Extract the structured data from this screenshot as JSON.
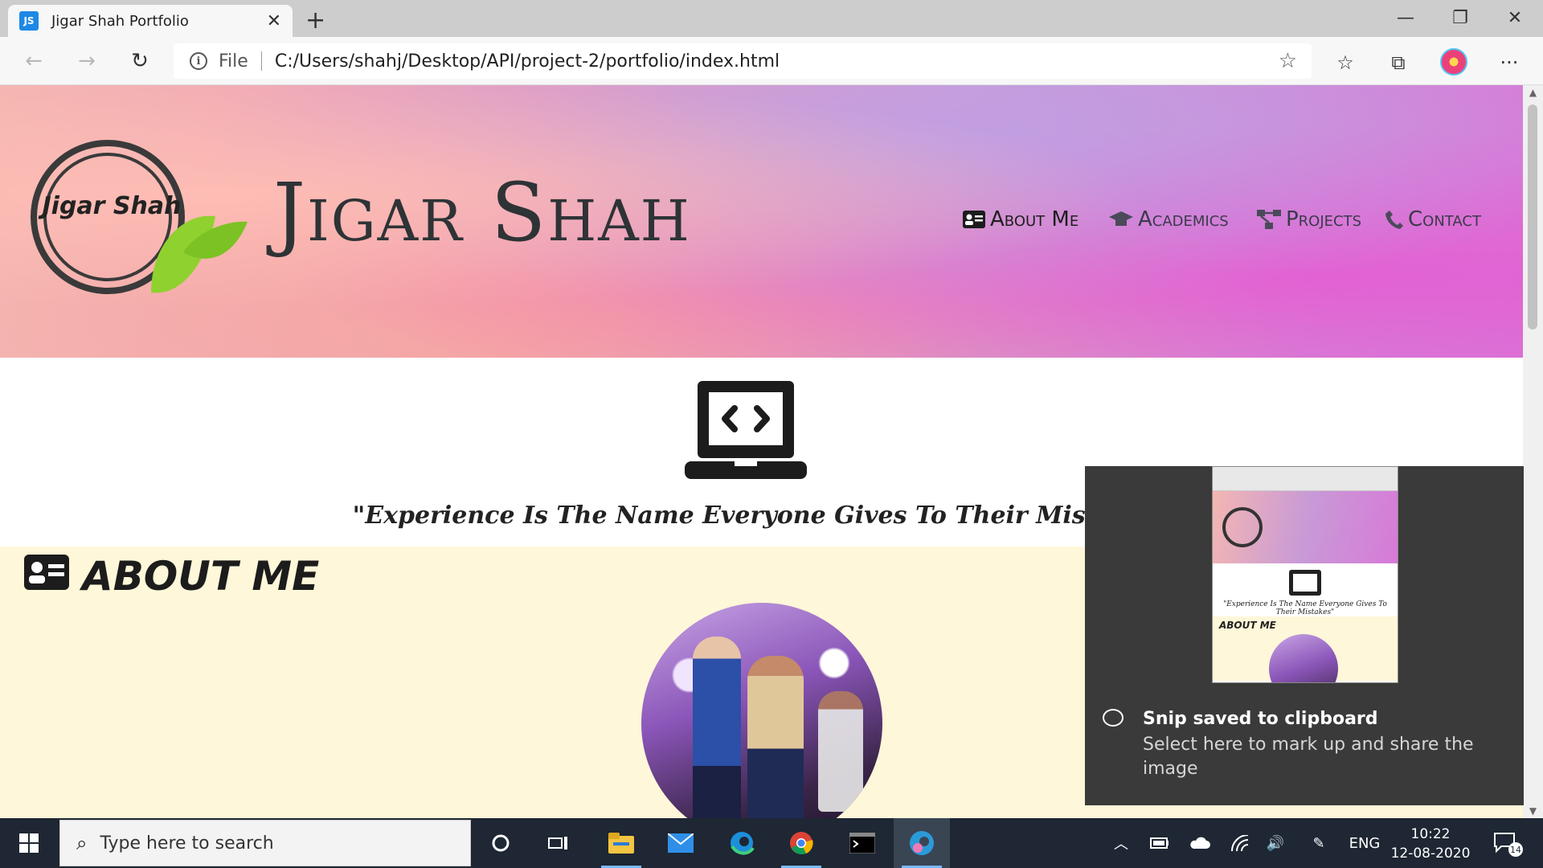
{
  "browser": {
    "tab_title": "Jigar Shah Portfolio",
    "tab_favicon": "JS",
    "new_tab": "+",
    "url_scheme": "File",
    "url": "C:/Users/shahj/Desktop/API/project-2/portfolio/index.html"
  },
  "page": {
    "logo_text": "Jigar Shah",
    "brand_title": "Jigar Shah",
    "nav": [
      {
        "label": "About Me",
        "icon": "id-card-icon"
      },
      {
        "label": "Academics",
        "icon": "graduation-cap-icon"
      },
      {
        "label": "Projects",
        "icon": "project-diagram-icon"
      },
      {
        "label": "Contact",
        "icon": "phone-icon"
      }
    ],
    "quote": "\"Experience Is The Name Everyone Gives To Their Mistakes\"",
    "about_title": "ABOUT ME"
  },
  "toast": {
    "preview_quote": "\"Experience Is The Name Everyone Gives To Their Mistakes\"",
    "preview_about": "ABOUT ME",
    "title": "Snip saved to clipboard",
    "body": "Select here to mark up and share the image"
  },
  "taskbar": {
    "search_placeholder": "Type here to search",
    "language": "ENG",
    "time": "10:22",
    "date": "12-08-2020",
    "notifications": "14"
  },
  "colors": {
    "hero_start": "#f4b6b2",
    "hero_end": "#d77ad8",
    "about_bg": "#fff7d9",
    "toast_bg": "#3a3a3a",
    "taskbar_bg": "#1e2733"
  }
}
